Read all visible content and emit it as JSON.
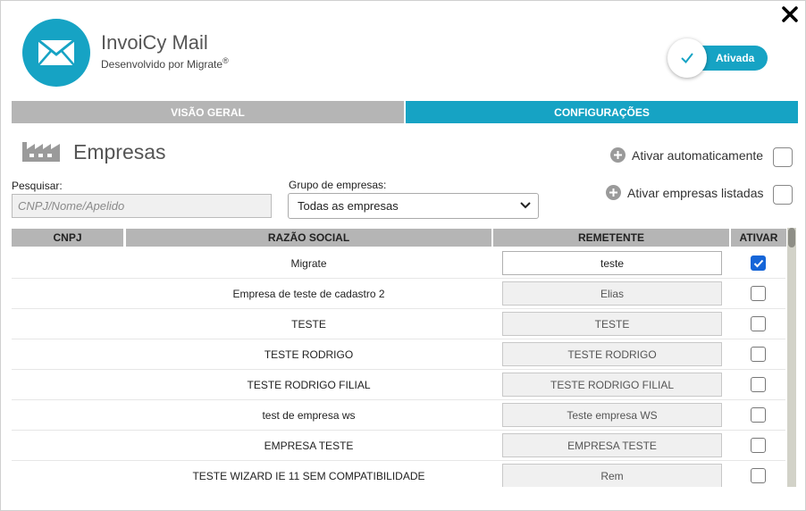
{
  "app": {
    "title": "InvoiCy Mail",
    "subtitle": "Desenvolvido por Migrate",
    "subtitle_mark": "®",
    "logo_icon": "envelope-icon",
    "close_icon": "close-icon"
  },
  "status_toggle": {
    "label": "Ativada",
    "state": "on",
    "icon": "checkmark-icon"
  },
  "tabs": [
    {
      "label": "VISÃO GERAL",
      "active": false
    },
    {
      "label": "CONFIGURAÇÕES",
      "active": true
    }
  ],
  "section": {
    "title": "Empresas",
    "icon": "factory-icon"
  },
  "options": {
    "auto_activate": {
      "label": "Ativar automaticamente",
      "checked": false,
      "icon": "plus-circle-icon"
    },
    "activate_listed": {
      "label": "Ativar empresas listadas",
      "checked": false,
      "icon": "plus-circle-icon"
    }
  },
  "search": {
    "label": "Pesquisar:",
    "placeholder": "CNPJ/Nome/Apelido",
    "value": ""
  },
  "group": {
    "label": "Grupo de empresas:",
    "selected": "Todas as empresas"
  },
  "table": {
    "columns": [
      "CNPJ",
      "RAZÃO SOCIAL",
      "REMETENTE",
      "ATIVAR"
    ],
    "rows": [
      {
        "cnpj": "",
        "razao": "Migrate",
        "remetente": "teste",
        "remetente_is_value": true,
        "ativar": true
      },
      {
        "cnpj": "",
        "razao": "Empresa de teste de cadastro 2",
        "remetente": "Elias",
        "remetente_is_value": false,
        "ativar": false
      },
      {
        "cnpj": "",
        "razao": "TESTE",
        "remetente": "TESTE",
        "remetente_is_value": false,
        "ativar": false
      },
      {
        "cnpj": "",
        "razao": "TESTE RODRIGO",
        "remetente": "TESTE RODRIGO",
        "remetente_is_value": false,
        "ativar": false
      },
      {
        "cnpj": "",
        "razao": "TESTE RODRIGO FILIAL",
        "remetente": "TESTE RODRIGO FILIAL",
        "remetente_is_value": false,
        "ativar": false
      },
      {
        "cnpj": "",
        "razao": "test de empresa ws",
        "remetente": "Teste empresa WS",
        "remetente_is_value": false,
        "ativar": false
      },
      {
        "cnpj": "",
        "razao": "EMPRESA TESTE",
        "remetente": "EMPRESA TESTE",
        "remetente_is_value": false,
        "ativar": false
      },
      {
        "cnpj": "",
        "razao": "TESTE WIZARD IE 11 SEM COMPATIBILIDADE",
        "remetente": "Rem",
        "remetente_is_value": false,
        "ativar": false
      }
    ]
  },
  "colors": {
    "accent": "#16a3c4",
    "header_gray": "#b5b5b5",
    "checkbox_checked": "#1565d8"
  }
}
